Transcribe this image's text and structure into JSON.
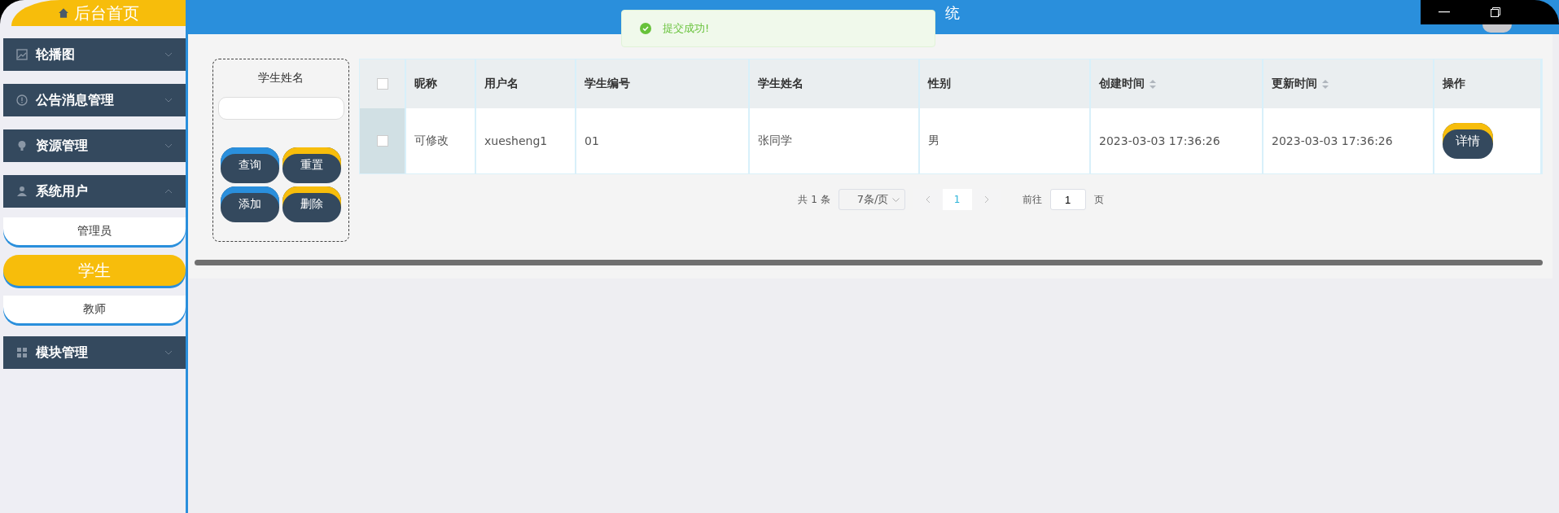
{
  "header": {
    "title": "统"
  },
  "toast": {
    "message": "提交成功!"
  },
  "sidebar": {
    "home": "后台首页",
    "menus": [
      {
        "label": "轮播图",
        "kind": "image",
        "expanded": false
      },
      {
        "label": "公告消息管理",
        "kind": "notice",
        "expanded": false
      },
      {
        "label": "资源管理",
        "kind": "bulb",
        "expanded": false
      },
      {
        "label": "系统用户",
        "kind": "user",
        "expanded": true,
        "children": [
          {
            "label": "管理员",
            "selected": false
          },
          {
            "label": "学生",
            "selected": true
          },
          {
            "label": "教师",
            "selected": false
          }
        ]
      },
      {
        "label": "模块管理",
        "kind": "grid",
        "expanded": false
      }
    ]
  },
  "search": {
    "label": "学生姓名",
    "buttons": [
      {
        "label": "查询",
        "kind": "blue"
      },
      {
        "label": "重置",
        "kind": "yellow"
      },
      {
        "label": "添加",
        "kind": "blue"
      },
      {
        "label": "删除",
        "kind": "yellow"
      }
    ]
  },
  "table": {
    "columns": [
      {
        "label": "昵称",
        "sortable": false
      },
      {
        "label": "用户名",
        "sortable": false
      },
      {
        "label": "学生编号",
        "sortable": false
      },
      {
        "label": "学生姓名",
        "sortable": false
      },
      {
        "label": "性别",
        "sortable": false
      },
      {
        "label": "创建时间",
        "sortable": true
      },
      {
        "label": "更新时间",
        "sortable": true
      },
      {
        "label": "操作",
        "sortable": false
      }
    ],
    "select_all": {
      "checked": false
    },
    "rows": [
      {
        "checked": false,
        "cells": [
          "可修改",
          "xuesheng1",
          "01",
          "张同学",
          "男",
          "2023-03-03 17:36:26",
          "2023-03-03 17:36:26"
        ],
        "action": "详情"
      }
    ]
  },
  "pagination": {
    "total": "共 1 条",
    "page_size": "7条/页",
    "pages": [
      {
        "label": "1",
        "selected": true
      }
    ],
    "goto_label": "前往",
    "goto_value": "1",
    "goto_suffix": "页"
  }
}
